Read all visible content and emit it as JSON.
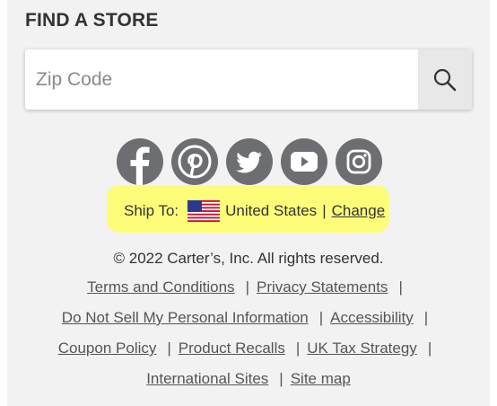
{
  "find_store": {
    "heading": "FIND A STORE",
    "zip_placeholder": "Zip Code",
    "search_icon": "magnifier-icon"
  },
  "social": [
    {
      "icon": "facebook-icon"
    },
    {
      "icon": "pinterest-icon"
    },
    {
      "icon": "twitter-icon"
    },
    {
      "icon": "youtube-icon"
    },
    {
      "icon": "instagram-icon"
    }
  ],
  "ship_to": {
    "label": "Ship To:",
    "country": "United States",
    "separator": "|",
    "change_label": "Change",
    "highlight_color": "#fdfd7a"
  },
  "footer": {
    "copyright": "© 2022 Carter’s, Inc. All rights reserved.",
    "links": {
      "terms": "Terms and Conditions",
      "privacy": "Privacy Statements",
      "do_not_sell": "Do Not Sell My Personal Information",
      "accessibility": "Accessibility",
      "coupon": "Coupon Policy",
      "recalls": "Product Recalls",
      "uk_tax": "UK Tax Strategy",
      "international": "International Sites",
      "site_map": "Site map"
    },
    "separator": "|"
  }
}
